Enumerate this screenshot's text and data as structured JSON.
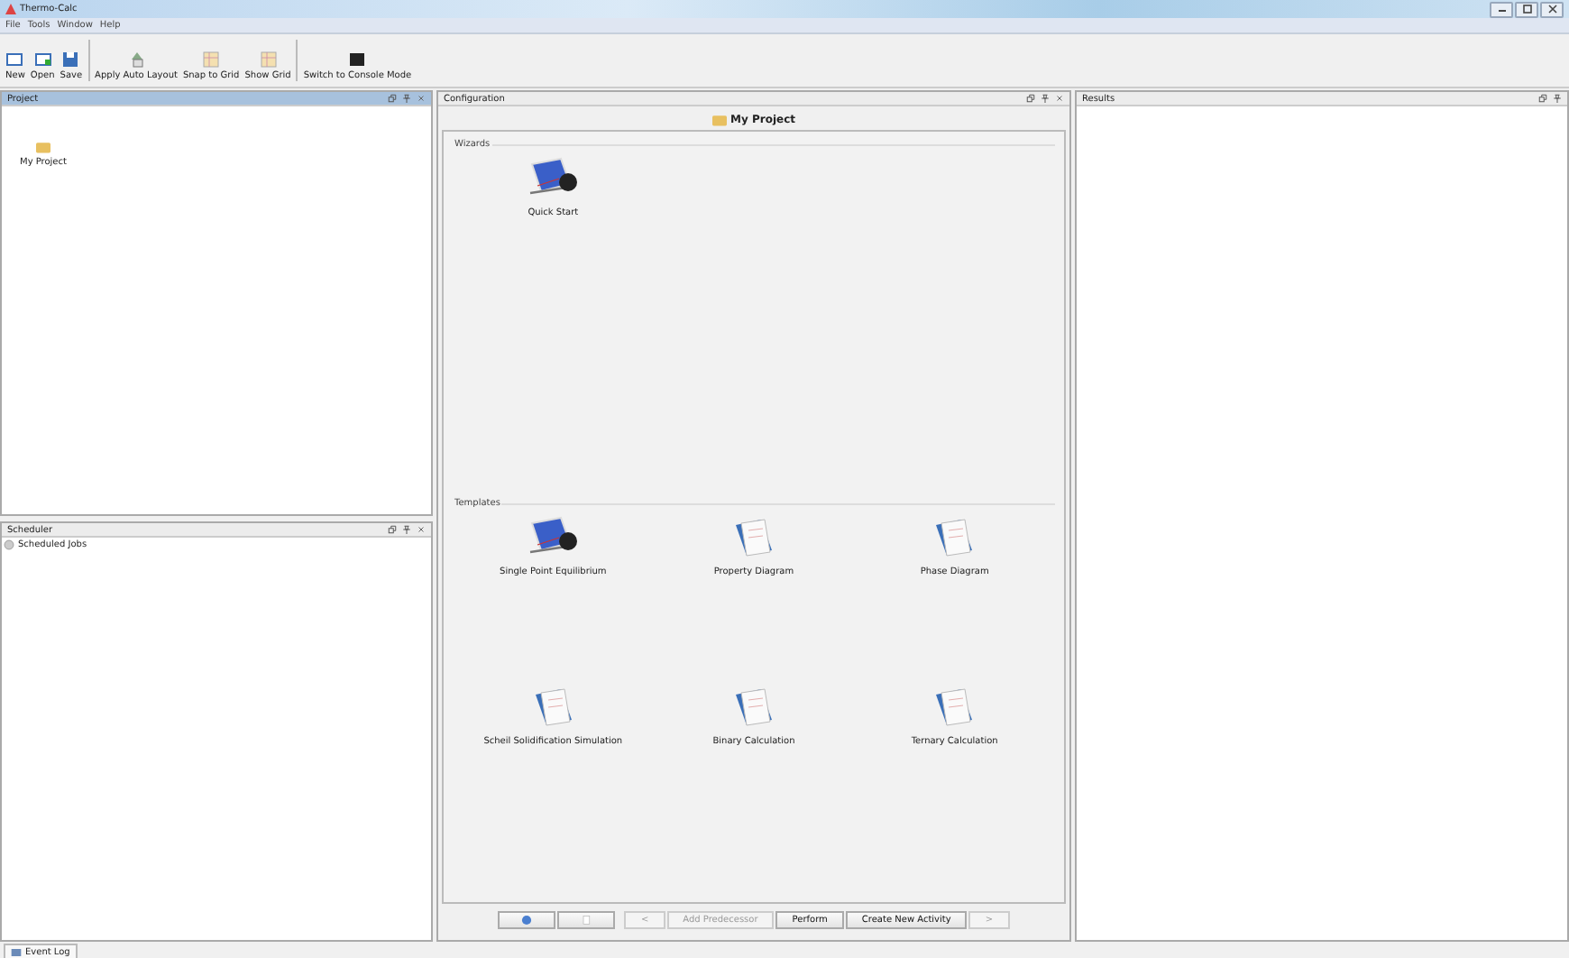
{
  "window": {
    "title": "Thermo-Calc"
  },
  "menu": [
    "File",
    "Tools",
    "Window",
    "Help"
  ],
  "toolbar": [
    {
      "label": "New",
      "kind": "window"
    },
    {
      "label": "Open",
      "kind": "open"
    },
    {
      "label": "Save",
      "kind": "save"
    },
    {
      "label": "Apply Auto Layout",
      "kind": "layout",
      "group_start": true
    },
    {
      "label": "Snap to Grid",
      "kind": "grid"
    },
    {
      "label": "Show Grid",
      "kind": "grid"
    },
    {
      "label": "Switch to Console Mode",
      "kind": "console",
      "group_start": true
    }
  ],
  "project_panel": {
    "title": "Project",
    "active": true,
    "items": [
      {
        "label": "My Project"
      }
    ]
  },
  "scheduler_panel": {
    "title": "Scheduler",
    "active": false,
    "items": [
      {
        "label": "Scheduled Jobs"
      }
    ]
  },
  "configuration_panel": {
    "title": "Configuration",
    "active": false,
    "header": "My Project",
    "sections": [
      {
        "title": "Wizards",
        "items": [
          {
            "label": "Quick Start",
            "kind": "wizard"
          }
        ]
      },
      {
        "title": "Templates",
        "items": [
          {
            "label": "Single Point Equilibrium",
            "kind": "wizard"
          },
          {
            "label": "Property Diagram",
            "kind": "document"
          },
          {
            "label": "Phase Diagram",
            "kind": "document"
          },
          {
            "label": "Scheil Solidification Simulation",
            "kind": "document"
          },
          {
            "label": "Binary Calculation",
            "kind": "document"
          },
          {
            "label": "Ternary Calculation",
            "kind": "document"
          }
        ]
      }
    ],
    "buttons": [
      {
        "kind": "help",
        "disabled": false
      },
      {
        "kind": "blank",
        "disabled": false
      },
      {
        "label": "<",
        "disabled": true
      },
      {
        "label": "Add Predecessor",
        "disabled": true
      },
      {
        "label": "Perform",
        "disabled": false
      },
      {
        "label": "Create New Activity",
        "disabled": false
      },
      {
        "label": ">",
        "disabled": true
      }
    ]
  },
  "results_panel": {
    "title": "Results",
    "active": false
  },
  "status_bar": {
    "tab": "Event Log"
  }
}
